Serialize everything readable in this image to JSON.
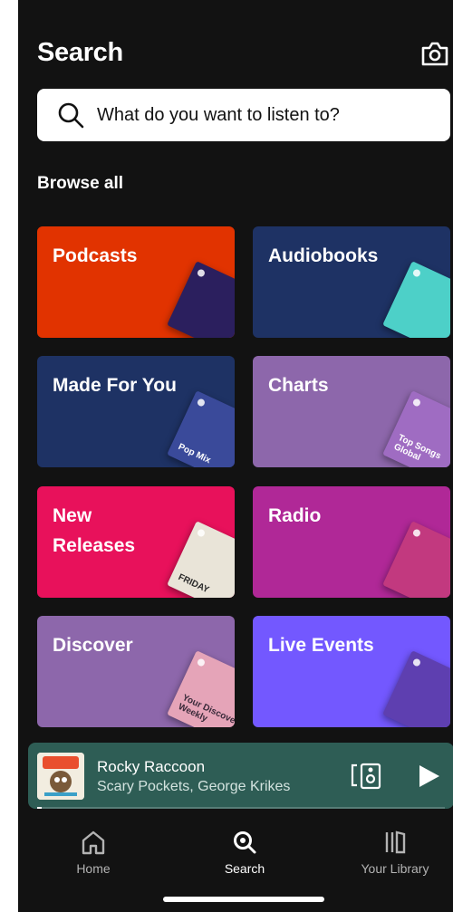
{
  "header": {
    "title": "Search",
    "camera_icon": "camera-icon"
  },
  "search": {
    "placeholder": "What do you want to listen to?",
    "icon": "search-icon"
  },
  "browse": {
    "title": "Browse all",
    "tiles": [
      {
        "label": "Podcasts",
        "color": "#e13300",
        "art_color": "#2b1f5e",
        "art_text": ""
      },
      {
        "label": "Audiobooks",
        "color": "#1e3264",
        "art_color": "#4dd0c8",
        "art_text": ""
      },
      {
        "label": "Made For You",
        "color": "#1e3264",
        "art_color": "#3a4a9a",
        "art_text": "Pop Mix"
      },
      {
        "label": "Charts",
        "color": "#8d67ab",
        "art_color": "#9f6cc2",
        "art_text": "Top Songs Global"
      },
      {
        "label": "New Releases",
        "color": "#e8115b",
        "art_color": "#e9e4d8",
        "art_text": "FRIDAY"
      },
      {
        "label": "Radio",
        "color": "#b02897",
        "art_color": "#c2397f",
        "art_text": ""
      },
      {
        "label": "Discover",
        "color": "#8d67ab",
        "art_color": "#e5a4b8",
        "art_text": "Your Discover Weekly"
      },
      {
        "label": "Live Events",
        "color": "#7358ff",
        "art_color": "#5e3fb0",
        "art_text": ""
      }
    ]
  },
  "now_playing": {
    "title": "Rocky Raccoon",
    "artist": "Scary Pockets, George Krikes",
    "background": "#2e5d55",
    "progress": 0.01
  },
  "nav": {
    "items": [
      {
        "label": "Home",
        "icon": "home-icon",
        "active": false
      },
      {
        "label": "Search",
        "icon": "search-icon",
        "active": true
      },
      {
        "label": "Your Library",
        "icon": "library-icon",
        "active": false
      }
    ]
  }
}
